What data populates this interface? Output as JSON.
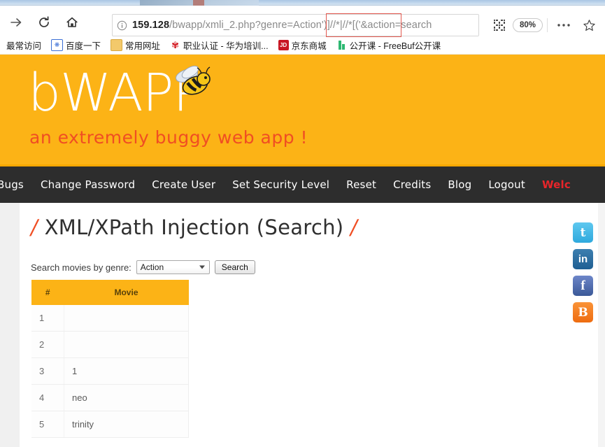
{
  "browser": {
    "nav": {
      "forward_icon": "arrow-right-icon",
      "reload_icon": "reload-icon",
      "home_icon": "home-icon"
    },
    "url": {
      "info_icon": "info-circle-icon",
      "host": "159.128",
      "path_query": "/bwapp/xmli_2.php?genre=Action')]//*|//*[('&action=search",
      "full": "159.128/bwapp/xmli_2.php?genre=Action')]//*|//*[('&action=search",
      "highlight_text": "Action')]",
      "highlight_color": "#e3584f"
    },
    "toolbar_right": {
      "qr_icon": "qr-code-icon",
      "zoom_level": "80%",
      "menu_icon": "ellipsis-icon",
      "bookmark_icon": "star-icon"
    },
    "bookmarks": [
      {
        "label": "最常访问",
        "icon": "none"
      },
      {
        "label": "百度一下",
        "icon": "baidu-icon",
        "icon_glyph": "❋"
      },
      {
        "label": "常用网址",
        "icon": "folder-icon"
      },
      {
        "label": "职业认证 - 华为培训...",
        "icon": "huawei-icon",
        "icon_glyph": "✾"
      },
      {
        "label": "京东商城",
        "icon": "jd-icon",
        "icon_glyph": "JD"
      },
      {
        "label": "公开课 - FreeBuf公开课",
        "icon": "freebuf-icon"
      }
    ]
  },
  "site": {
    "banner": {
      "logo_text": "bWAPP",
      "tagline": "an extremely buggy web app !",
      "bee_icon": "bee-icon",
      "bg_color": "#fcb316",
      "tagline_color": "#f04e23"
    },
    "navbar": {
      "items": [
        {
          "label": "Bugs"
        },
        {
          "label": "Change Password"
        },
        {
          "label": "Create User"
        },
        {
          "label": "Set Security Level"
        },
        {
          "label": "Reset"
        },
        {
          "label": "Credits"
        },
        {
          "label": "Blog"
        },
        {
          "label": "Logout"
        },
        {
          "label": "Welc",
          "highlight": true,
          "color": "#e8252a"
        }
      ]
    },
    "main": {
      "title_prefix": "/",
      "title": "XML/XPath Injection (Search)",
      "title_suffix": "/",
      "search": {
        "label": "Search movies by genre:",
        "selected_genre": "Action",
        "button_label": "Search"
      },
      "table": {
        "headers": {
          "index": "#",
          "movie": "Movie"
        },
        "rows": [
          {
            "index": "1",
            "movie": ""
          },
          {
            "index": "2",
            "movie": ""
          },
          {
            "index": "3",
            "movie": "1"
          },
          {
            "index": "4",
            "movie": "neo"
          },
          {
            "index": "5",
            "movie": "trinity"
          }
        ]
      }
    },
    "social": [
      {
        "name": "twitter-icon",
        "glyph": "t"
      },
      {
        "name": "linkedin-icon",
        "glyph": "in"
      },
      {
        "name": "facebook-icon",
        "glyph": "f"
      },
      {
        "name": "blogger-icon",
        "glyph": "B"
      }
    ]
  }
}
